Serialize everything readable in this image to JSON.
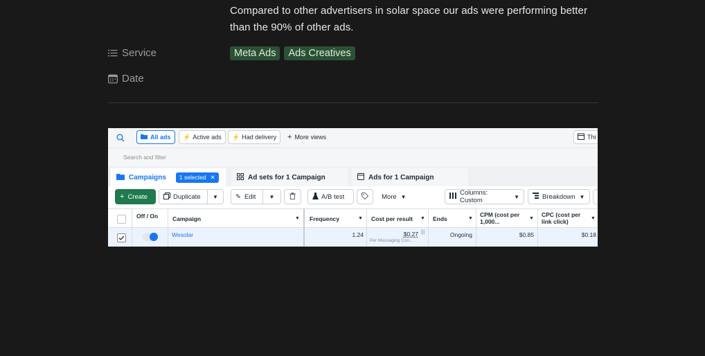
{
  "description": "Compared to other advertisers in solar space our ads were performing better than the 90% of other ads.",
  "properties": [
    {
      "icon": "list-icon",
      "label": "Service"
    },
    {
      "icon": "calendar-icon",
      "label": "Date"
    }
  ],
  "service_tags": [
    "Meta Ads",
    "Ads Creatives"
  ],
  "colors": {
    "background": "#191919",
    "tag_bg": "#2b5135",
    "accent": "#1877f2",
    "create_green": "#1f7a4d"
  },
  "screenshot": {
    "top_buttons": [
      "All ads",
      "Active ads",
      "Had delivery",
      "More views",
      "Thi"
    ],
    "search_placeholder": "Search and filter",
    "tabs": {
      "campaigns": "Campaigns",
      "selected": "1 selected",
      "adsets": "Ad sets for 1 Campaign",
      "ads": "Ads for 1 Campaign"
    },
    "toolbar": {
      "create": "Create",
      "duplicate": "Duplicate",
      "edit": "Edit",
      "ab_test": "A/B test",
      "more": "More",
      "columns": "Columns: Custom",
      "breakdown": "Breakdown"
    },
    "columns": [
      "Off / On",
      "Campaign",
      "Frequency",
      "Cost per result",
      "Ends",
      "CPM (cost per 1,000...",
      "CPC (cost per link click)"
    ],
    "row": {
      "campaign": "Wesolar",
      "frequency": "1.24",
      "cost_per_result": "$0.27",
      "cost_per_result_sub": "Per Messaging Con...",
      "ends": "Ongoing",
      "cpm": "$0.85",
      "cpc": "$0.18",
      "toggle_on": true,
      "selected": true
    }
  }
}
